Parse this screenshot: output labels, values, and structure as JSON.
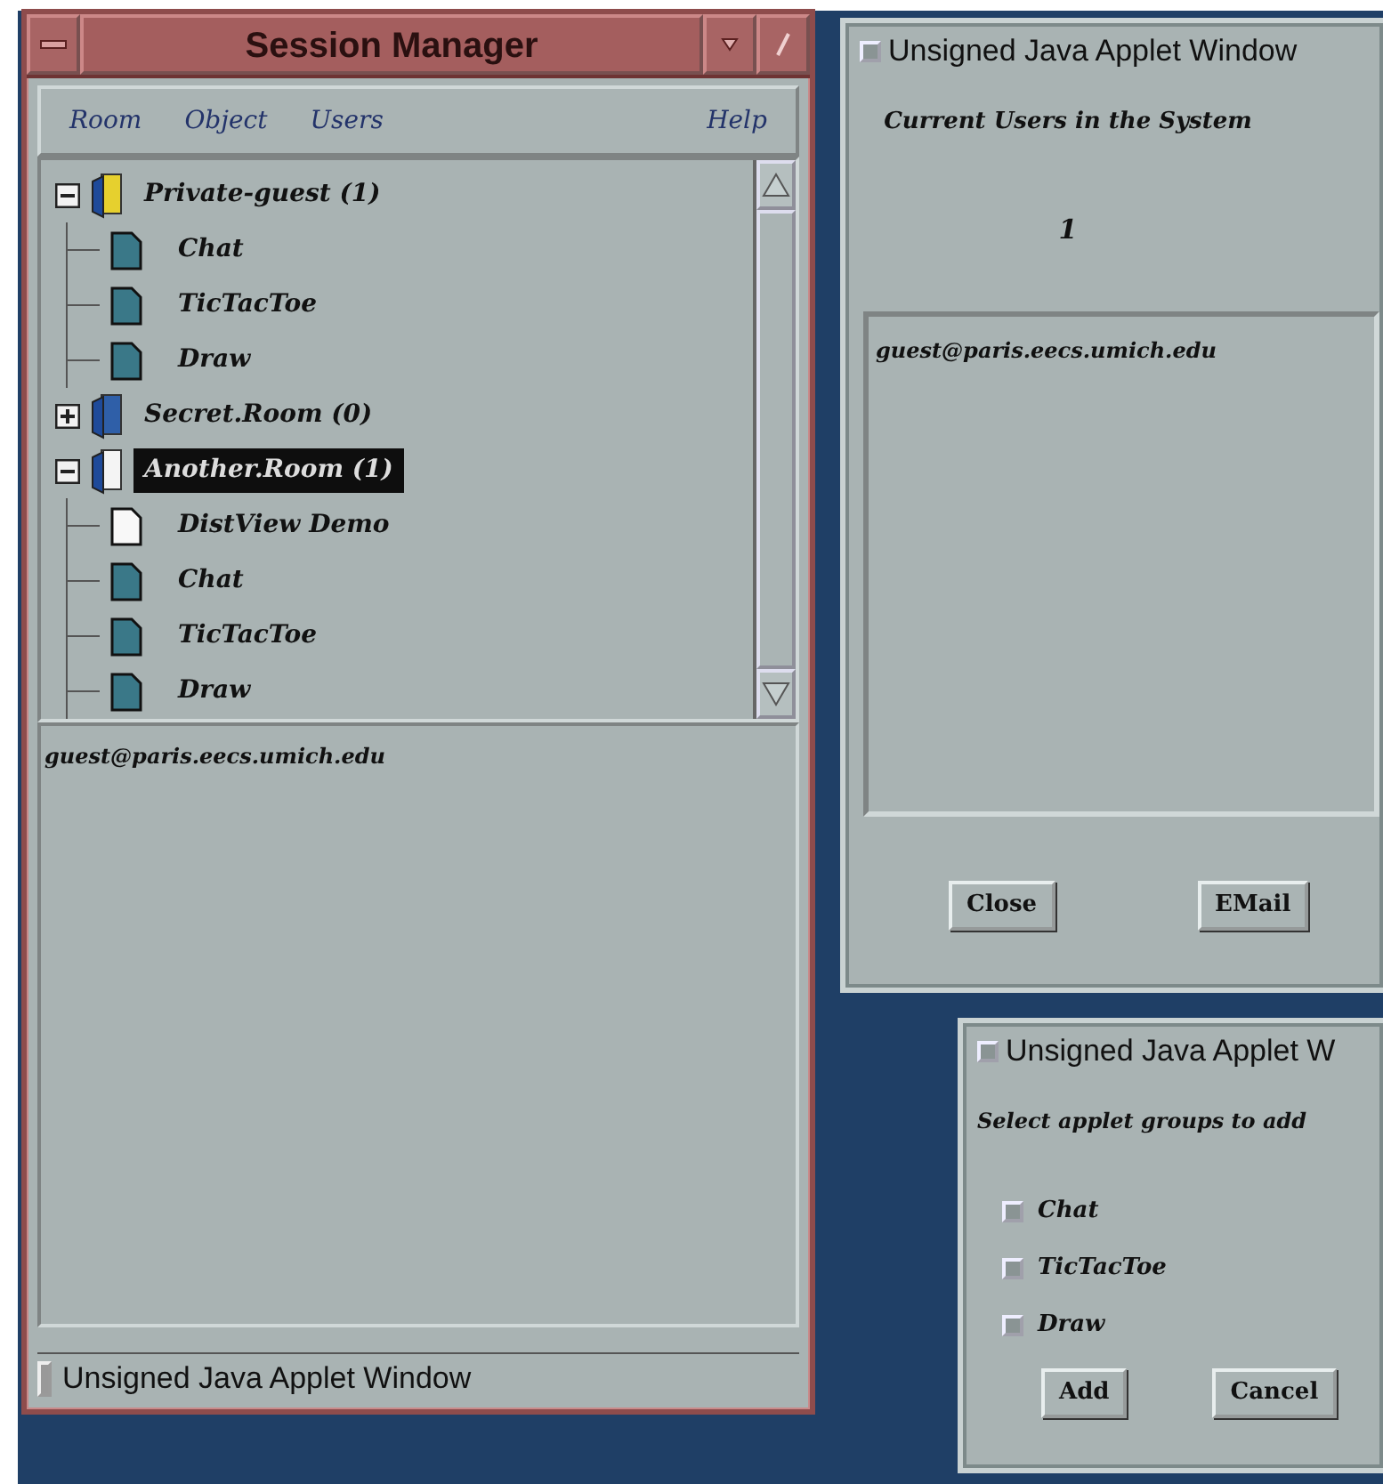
{
  "session_manager": {
    "title": "Session Manager",
    "menu": [
      {
        "label": "Room"
      },
      {
        "label": "Object"
      },
      {
        "label": "Users"
      },
      {
        "label": "Help"
      }
    ],
    "tree": [
      {
        "label": "Private-guest (1)",
        "expanded": true,
        "selected": false,
        "color": "#e6d02e",
        "children": [
          {
            "label": "Chat",
            "color": "#3a7888"
          },
          {
            "label": "TicTacToe",
            "color": "#3a7888"
          },
          {
            "label": "Draw",
            "color": "#3a7888"
          }
        ]
      },
      {
        "label": "Secret.Room (0)",
        "expanded": false,
        "selected": false,
        "color": "#2f5fa8"
      },
      {
        "label": "Another.Room (1)",
        "expanded": true,
        "selected": true,
        "color": "#f4f4f4",
        "children": [
          {
            "label": "DistView Demo",
            "color": "#f8f8f8"
          },
          {
            "label": "Chat",
            "color": "#3a7888"
          },
          {
            "label": "TicTacToe",
            "color": "#3a7888"
          },
          {
            "label": "Draw",
            "color": "#3a7888"
          }
        ]
      }
    ],
    "users": [
      "guest@paris.eecs.umich.edu"
    ],
    "status_bar": "Unsigned Java Applet Window"
  },
  "users_window": {
    "status": "Unsigned Java Applet Window",
    "heading": "Current Users in the System",
    "count": "1",
    "users": [
      "guest@paris.eecs.umich.edu"
    ],
    "buttons": [
      "Close",
      "EMail"
    ]
  },
  "add_window": {
    "status": "Unsigned Java Applet W",
    "prompt": "Select applet groups to add",
    "options": [
      {
        "label": "Chat",
        "checked": false
      },
      {
        "label": "TicTacToe",
        "checked": false
      },
      {
        "label": "Draw",
        "checked": false
      }
    ],
    "buttons": [
      "Add",
      "Cancel"
    ]
  }
}
